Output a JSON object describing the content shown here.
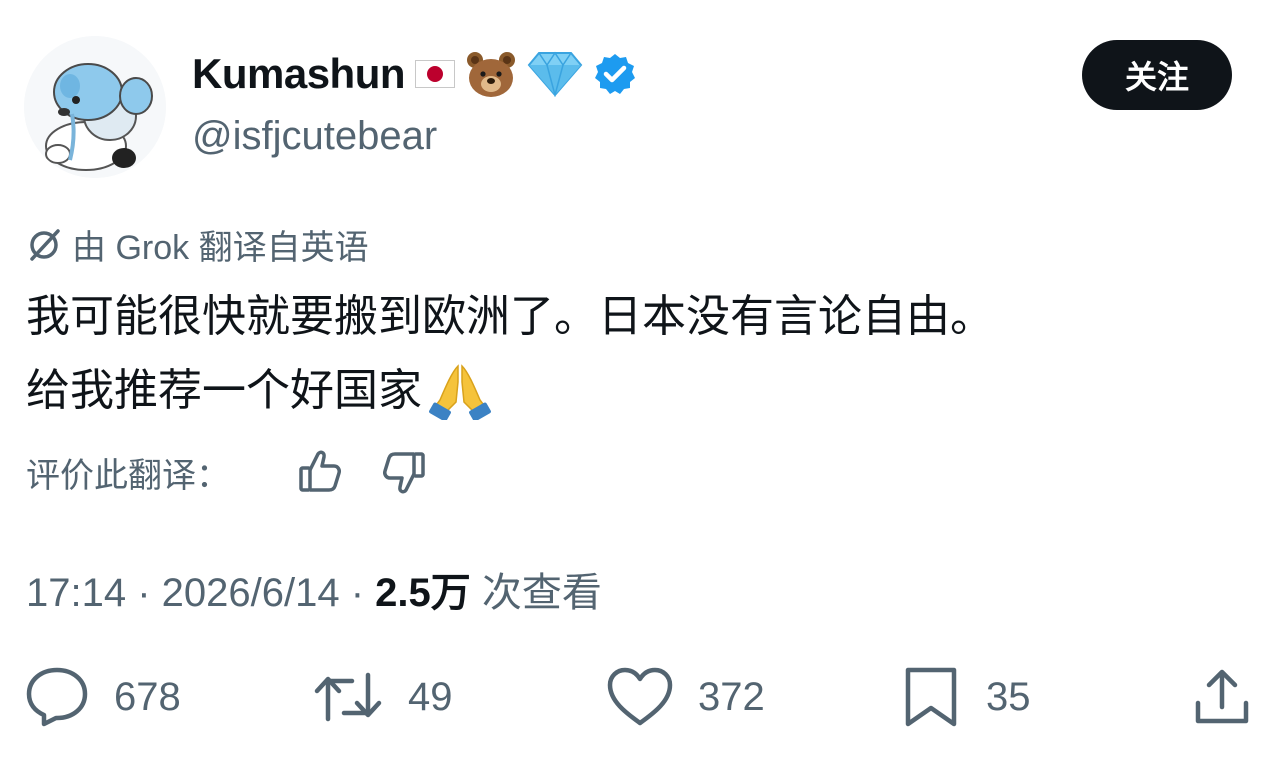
{
  "user": {
    "display_name": "Kumashun",
    "badges": [
      "japan-flag-icon",
      "bear-face-icon",
      "gem-icon",
      "verified-badge-icon"
    ],
    "handle": "@isfjcutebear"
  },
  "follow_label": "关注",
  "translation": {
    "notice": "由 Grok 翻译自英语",
    "rate_label": "评价此翻译："
  },
  "tweet": {
    "line1": "我可能很快就要搬到欧洲了。日本没有言论自由。",
    "line2": "给我推荐一个好国家"
  },
  "meta": {
    "time": "17:14",
    "sep1": " · ",
    "date": "2026/6/14",
    "sep2": " · ",
    "views": "2.5万",
    "views_label": " 次查看"
  },
  "actions": {
    "replies": "678",
    "retweets": "49",
    "likes": "372",
    "bookmarks": "35"
  },
  "colors": {
    "text": "#0f1419",
    "secondary": "#536471",
    "verified": "#1d9bf0",
    "button_bg": "#0f1419"
  }
}
